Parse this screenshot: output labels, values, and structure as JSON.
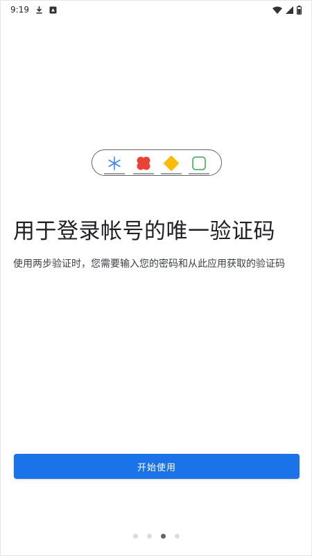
{
  "status_bar": {
    "time": "9:19",
    "left_icons": [
      "download-icon",
      "notification-icon"
    ],
    "right_icons": [
      "wifi-icon",
      "signal-icon",
      "battery-icon"
    ]
  },
  "illustration": {
    "tokens": [
      "asterisk-icon",
      "red-flower-icon",
      "yellow-diamond-icon",
      "green-square-icon"
    ],
    "colors": {
      "asterisk": "#4285f4",
      "red": "#ea4335",
      "yellow": "#fbbc04",
      "green": "#34a853",
      "outline": "#5f6368"
    }
  },
  "main": {
    "headline": "用于登录帐号的唯一验证码",
    "description": "使用两步验证时，您需要输入您的密码和从此应用获取的验证码"
  },
  "actions": {
    "primary_label": "开始使用"
  },
  "pagination": {
    "count": 4,
    "active_index": 2
  },
  "theme": {
    "accent": "#1a73e8"
  }
}
